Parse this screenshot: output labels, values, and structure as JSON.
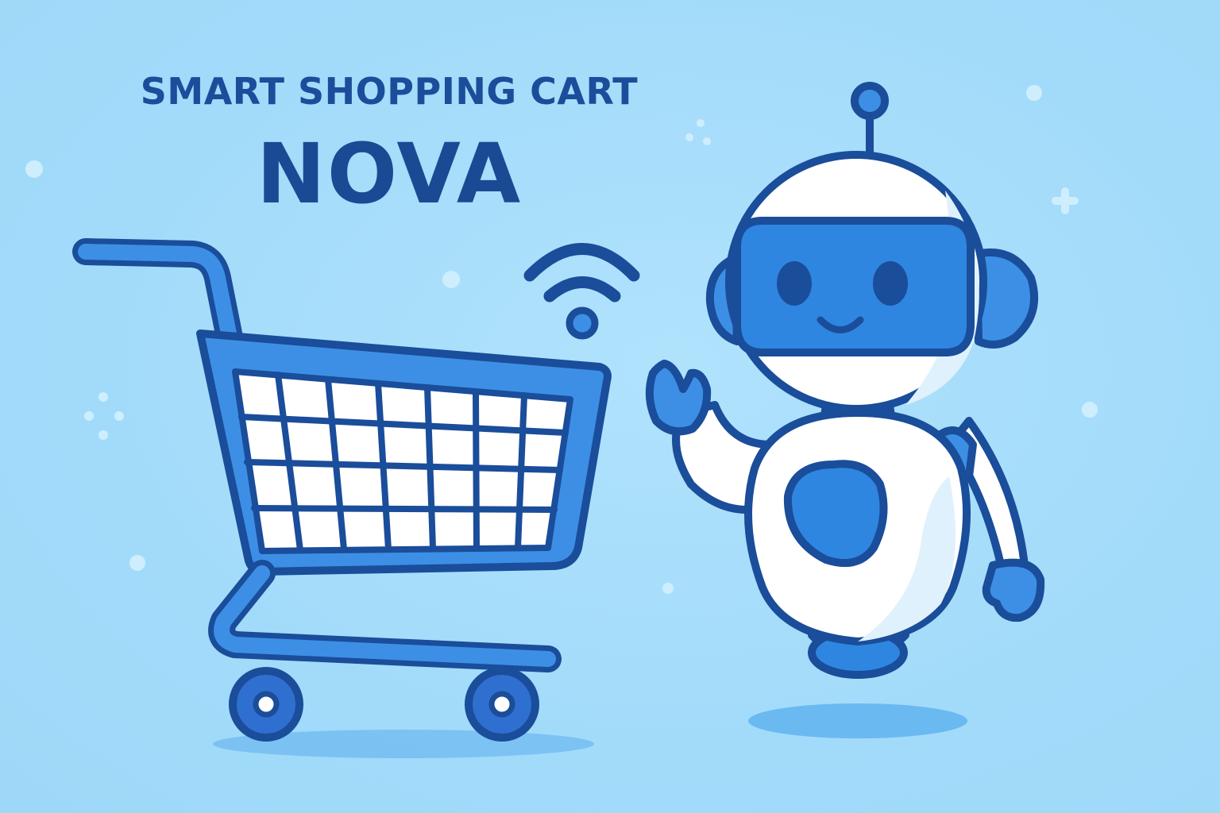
{
  "header": {
    "subtitle": "SMART SHOPPING CART",
    "brand": "NOVA"
  },
  "icons": {
    "wifi": "wifi-signal-icon",
    "cart": "shopping-cart-icon",
    "robot": "robot-mascot-icon",
    "sparkles": "sparkle-icon"
  },
  "colors": {
    "background": "#a4dcfa",
    "outline": "#1a4d9a",
    "cart_blue": "#3d8fe6",
    "robot_white": "#ffffff",
    "accent_blue": "#2f86e0"
  }
}
